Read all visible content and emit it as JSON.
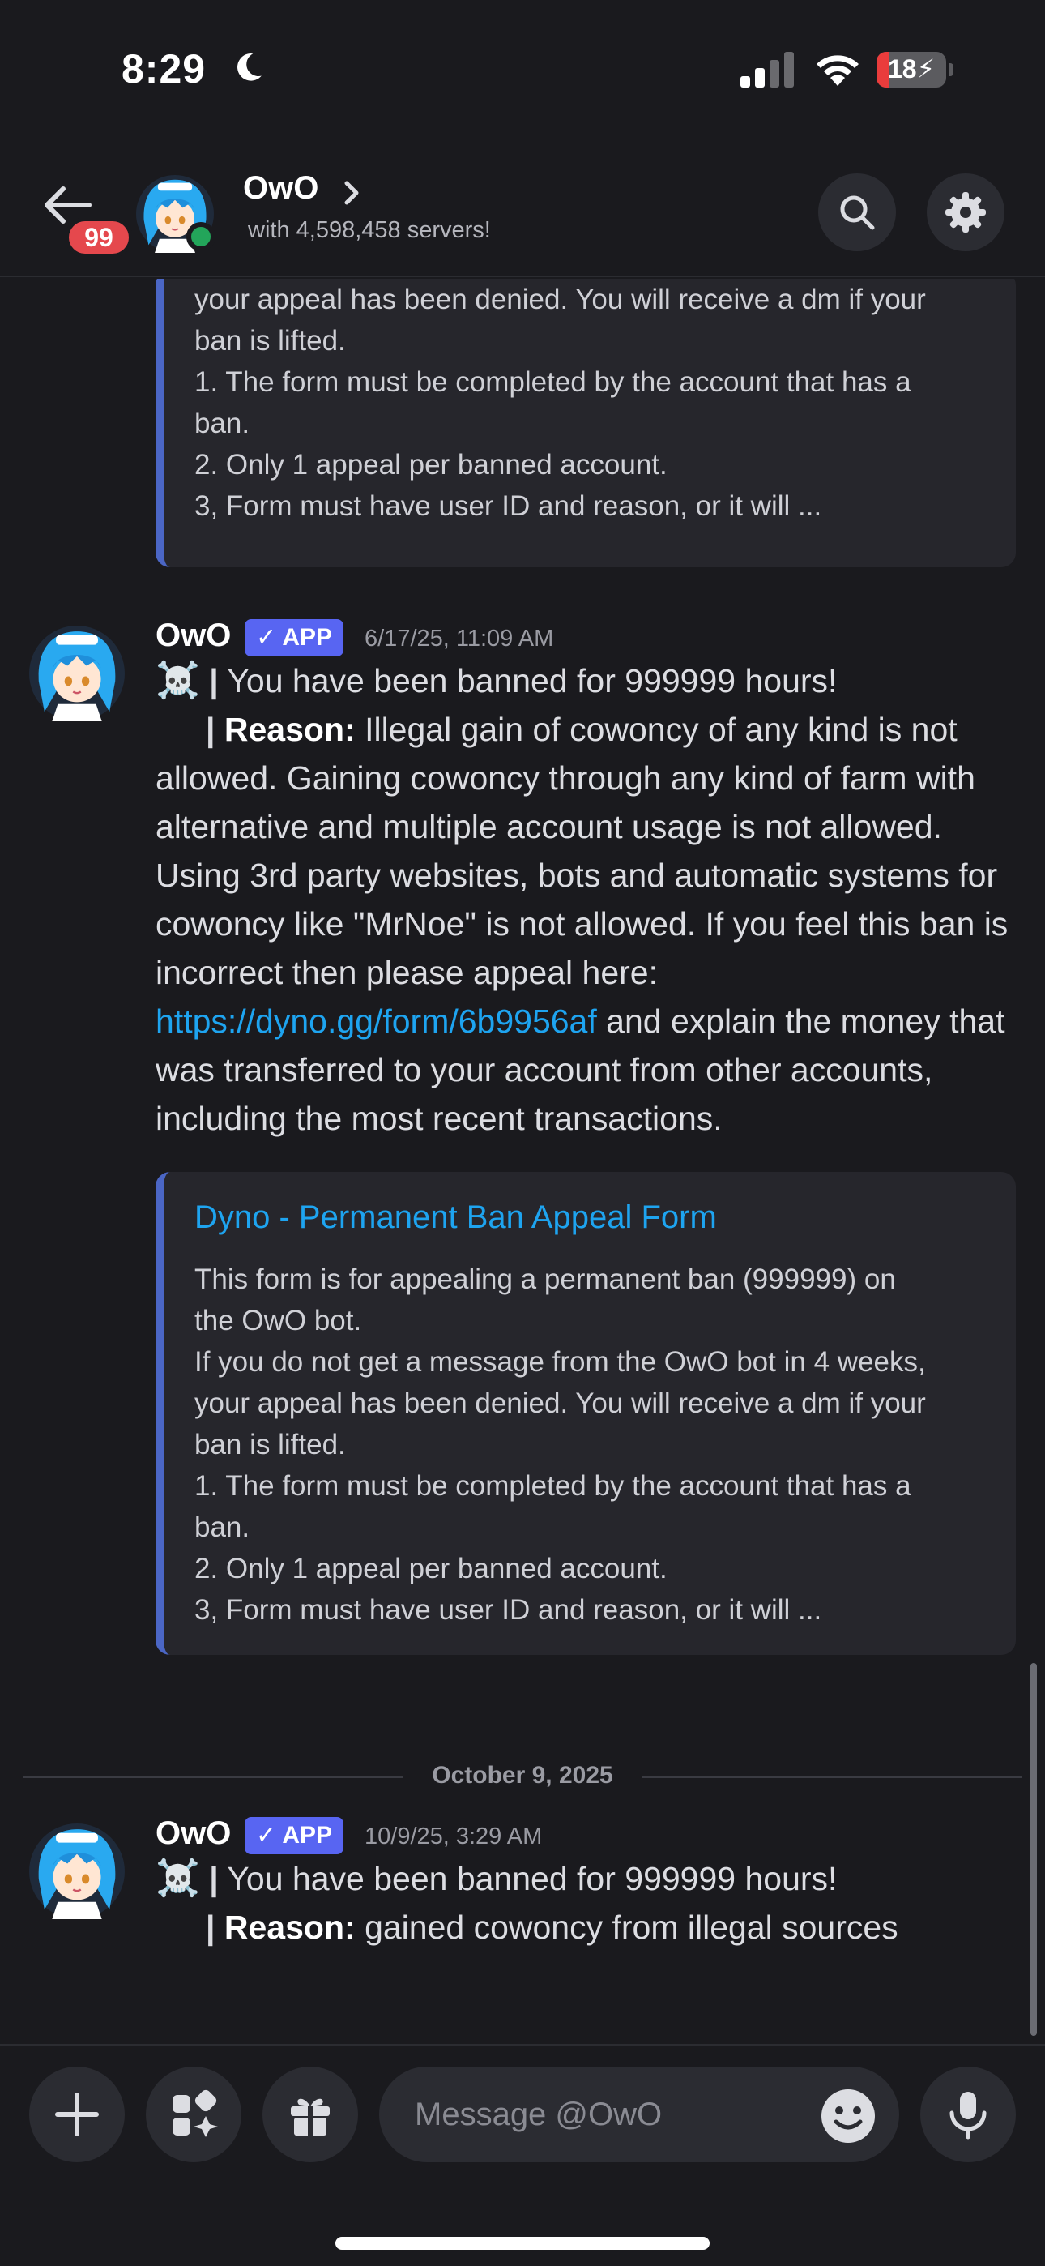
{
  "status_bar": {
    "time": "8:29",
    "battery_level": "18",
    "battery_fraction": 0.18,
    "icons": [
      "moon-icon",
      "cellular-signal-icon",
      "wifi-icon",
      "battery-charging-icon"
    ]
  },
  "header": {
    "unread_count": "99",
    "channel_name": "OwO",
    "subtitle": "with 4,598,458 servers!",
    "icons": [
      "back-arrow-icon",
      "chevron-right-icon",
      "search-icon",
      "gear-icon"
    ]
  },
  "messages": [
    {
      "type": "embed-continuation",
      "embed": {
        "description": "your appeal has been denied. You will receive a dm if your\nban is lifted.\n1. The form must be completed by the account that has a\nban.\n2. Only 1 appeal per banned account.\n3, Form must have user ID and reason, or it will ..."
      }
    },
    {
      "author": "OwO",
      "tag": "✓ APP",
      "timestamp": "6/17/25, 11:09 AM",
      "skull": "☠️",
      "headline": "You have been banned for 999999 hours!",
      "reason_label": "Reason:",
      "reason_text": "Illegal gain of cowoncy of any kind is not allowed. Gaining cowoncy through any kind of farm with alternative and multiple account usage is not allowed. Using 3rd party websites, bots and automatic systems for cowoncy like \"MrNoe\" is not allowed. If you feel this ban is incorrect then please appeal here: ",
      "link": "https://dyno.gg/form/6b9956af",
      "reason_text_after": " and explain the money that was transferred to your account from other accounts, including the most recent transactions.",
      "embed": {
        "title": "Dyno - Permanent Ban Appeal  Form",
        "description": "This form is for appealing a permanent ban (999999) on\nthe OwO bot.\nIf you do not get a message from the OwO bot in 4 weeks,\nyour appeal has been denied. You will receive a dm if your\nban is lifted.\n1. The form must be completed by the account that has a\nban.\n2. Only 1 appeal per banned account.\n3, Form must have user ID and reason, or it will ..."
      }
    },
    {
      "author": "OwO",
      "tag": "✓ APP",
      "timestamp": "10/9/25, 3:29 AM",
      "skull": "☠️",
      "headline": "You have been banned for 999999 hours!",
      "reason_label": "Reason:",
      "reason_text": "gained cowoncy from illegal sources"
    }
  ],
  "date_divider": "October 9, 2025",
  "composer": {
    "placeholder": "Message @OwO",
    "icons": [
      "plus-icon",
      "apps-icon",
      "gift-icon",
      "emoji-icon",
      "microphone-icon"
    ]
  },
  "colors": {
    "background": "#1a1a1e",
    "link": "#1ea4f0",
    "app_tag": "#5865f2",
    "embed_border": "#4b66c5",
    "badge": "#e5484d",
    "online": "#23a55a"
  }
}
